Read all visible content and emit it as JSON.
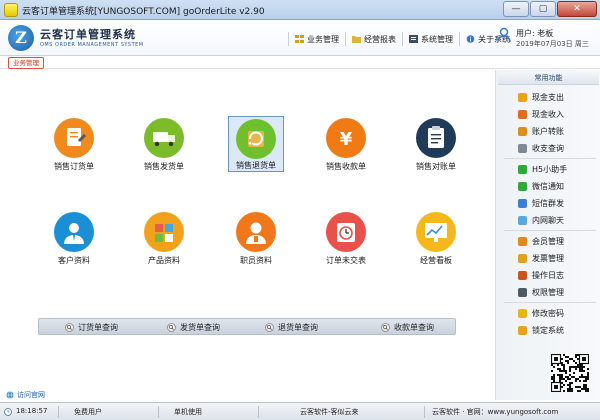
{
  "window": {
    "title": "云客订单管理系统[YUNGOSOFT.COM]  goOrderLite v2.90",
    "buttons": {
      "minimize": "—",
      "maximize": "▢",
      "close": "✕"
    }
  },
  "header": {
    "logo_letter": "Z",
    "brand_cn": "云客订单管理系统",
    "brand_en": "OMS ORDER MANAGEMENT SYSTEM",
    "nav": [
      {
        "label": "业务管理",
        "icon": "grid-icon"
      },
      {
        "label": "经营报表",
        "icon": "folder-icon"
      },
      {
        "label": "系统管理",
        "icon": "list-icon"
      },
      {
        "label": "关于系统",
        "icon": "info-icon"
      }
    ],
    "user": {
      "name": "用户: 老板",
      "date": "2019年07月03日 周三"
    }
  },
  "tab": {
    "label": "业务管理"
  },
  "tiles": [
    {
      "label": "销售订货单",
      "icon": "order-icon",
      "color": "#f18a1e"
    },
    {
      "label": "销售发货单",
      "icon": "truck-icon",
      "color": "#7cbc2a"
    },
    {
      "label": "销售退货单",
      "icon": "return-icon",
      "color": "#6ec12d"
    },
    {
      "label": "销售收款单",
      "icon": "yen-icon",
      "color": "#f07b14"
    },
    {
      "label": "销售对账单",
      "icon": "clipboard-icon",
      "color": "#1f3b57"
    },
    {
      "label": "客户资料",
      "icon": "customer-icon",
      "color": "#1a8fd6"
    },
    {
      "label": "产品资料",
      "icon": "product-icon",
      "color": "#f0a21c"
    },
    {
      "label": "职员资料",
      "icon": "employee-icon",
      "color": "#f0781a"
    },
    {
      "label": "订单未交表",
      "icon": "clock-icon",
      "color": "#e8524a"
    },
    {
      "label": "经营看板",
      "icon": "board-icon",
      "color": "#f5b71c"
    }
  ],
  "selected_tile": 2,
  "query_bar": [
    {
      "label": "订货单查询"
    },
    {
      "label": "发货单查询"
    },
    {
      "label": "退货单查询"
    },
    {
      "label": "收款单查询"
    }
  ],
  "website_link": "访问官网",
  "sidebar": {
    "title": "常用功能",
    "groups": [
      [
        {
          "label": "现金支出",
          "color": "#e8a317"
        },
        {
          "label": "现金收入",
          "color": "#e06d1a"
        },
        {
          "label": "账户转账",
          "color": "#d98f1a"
        },
        {
          "label": "收支查询",
          "color": "#7d8a96"
        }
      ],
      [
        {
          "label": "H5小助手",
          "color": "#2eaa36"
        },
        {
          "label": "微信通知",
          "color": "#2eaa36"
        },
        {
          "label": "短信群发",
          "color": "#3c7fd1"
        },
        {
          "label": "内网聊天",
          "color": "#5aa8e0"
        }
      ],
      [
        {
          "label": "会员管理",
          "color": "#e08a1a"
        },
        {
          "label": "发票管理",
          "color": "#e2a21c"
        },
        {
          "label": "操作日志",
          "color": "#c8561e"
        },
        {
          "label": "权限管理",
          "color": "#505a64"
        }
      ],
      [
        {
          "label": "修改密码",
          "color": "#e6b51c"
        },
        {
          "label": "锁定系统",
          "color": "#e6a31c"
        }
      ]
    ]
  },
  "status": {
    "time": "18:18:57",
    "user_type": "免费用户",
    "mode": "单机使用",
    "vendor": "云客软件-客似云来",
    "site": "云客软件 · 官网：www.yungosoft.com"
  }
}
